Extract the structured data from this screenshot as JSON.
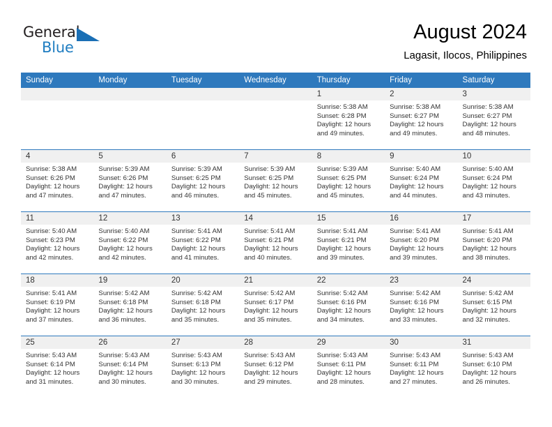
{
  "brand": {
    "name_part1": "General",
    "name_part2": "Blue",
    "triangle_icon": "triangle-icon"
  },
  "header": {
    "title": "August 2024",
    "subtitle": "Lagasit, Ilocos, Philippines"
  },
  "colors": {
    "header_blue": "#2e79bd",
    "brand_blue": "#1f7dc1",
    "daynum_bg": "#f0f0f0",
    "text": "#333333"
  },
  "weekdays": [
    "Sunday",
    "Monday",
    "Tuesday",
    "Wednesday",
    "Thursday",
    "Friday",
    "Saturday"
  ],
  "labels": {
    "sunrise_prefix": "Sunrise:",
    "sunset_prefix": "Sunset:",
    "daylight_prefix": "Daylight:"
  },
  "weeks": [
    [
      {
        "day": "",
        "empty": true
      },
      {
        "day": "",
        "empty": true
      },
      {
        "day": "",
        "empty": true
      },
      {
        "day": "",
        "empty": true
      },
      {
        "day": "1",
        "sunrise": "Sunrise: 5:38 AM",
        "sunset": "Sunset: 6:28 PM",
        "daylight1": "Daylight: 12 hours",
        "daylight2": "and 49 minutes."
      },
      {
        "day": "2",
        "sunrise": "Sunrise: 5:38 AM",
        "sunset": "Sunset: 6:27 PM",
        "daylight1": "Daylight: 12 hours",
        "daylight2": "and 49 minutes."
      },
      {
        "day": "3",
        "sunrise": "Sunrise: 5:38 AM",
        "sunset": "Sunset: 6:27 PM",
        "daylight1": "Daylight: 12 hours",
        "daylight2": "and 48 minutes."
      }
    ],
    [
      {
        "day": "4",
        "sunrise": "Sunrise: 5:38 AM",
        "sunset": "Sunset: 6:26 PM",
        "daylight1": "Daylight: 12 hours",
        "daylight2": "and 47 minutes."
      },
      {
        "day": "5",
        "sunrise": "Sunrise: 5:39 AM",
        "sunset": "Sunset: 6:26 PM",
        "daylight1": "Daylight: 12 hours",
        "daylight2": "and 47 minutes."
      },
      {
        "day": "6",
        "sunrise": "Sunrise: 5:39 AM",
        "sunset": "Sunset: 6:25 PM",
        "daylight1": "Daylight: 12 hours",
        "daylight2": "and 46 minutes."
      },
      {
        "day": "7",
        "sunrise": "Sunrise: 5:39 AM",
        "sunset": "Sunset: 6:25 PM",
        "daylight1": "Daylight: 12 hours",
        "daylight2": "and 45 minutes."
      },
      {
        "day": "8",
        "sunrise": "Sunrise: 5:39 AM",
        "sunset": "Sunset: 6:25 PM",
        "daylight1": "Daylight: 12 hours",
        "daylight2": "and 45 minutes."
      },
      {
        "day": "9",
        "sunrise": "Sunrise: 5:40 AM",
        "sunset": "Sunset: 6:24 PM",
        "daylight1": "Daylight: 12 hours",
        "daylight2": "and 44 minutes."
      },
      {
        "day": "10",
        "sunrise": "Sunrise: 5:40 AM",
        "sunset": "Sunset: 6:24 PM",
        "daylight1": "Daylight: 12 hours",
        "daylight2": "and 43 minutes."
      }
    ],
    [
      {
        "day": "11",
        "sunrise": "Sunrise: 5:40 AM",
        "sunset": "Sunset: 6:23 PM",
        "daylight1": "Daylight: 12 hours",
        "daylight2": "and 42 minutes."
      },
      {
        "day": "12",
        "sunrise": "Sunrise: 5:40 AM",
        "sunset": "Sunset: 6:22 PM",
        "daylight1": "Daylight: 12 hours",
        "daylight2": "and 42 minutes."
      },
      {
        "day": "13",
        "sunrise": "Sunrise: 5:41 AM",
        "sunset": "Sunset: 6:22 PM",
        "daylight1": "Daylight: 12 hours",
        "daylight2": "and 41 minutes."
      },
      {
        "day": "14",
        "sunrise": "Sunrise: 5:41 AM",
        "sunset": "Sunset: 6:21 PM",
        "daylight1": "Daylight: 12 hours",
        "daylight2": "and 40 minutes."
      },
      {
        "day": "15",
        "sunrise": "Sunrise: 5:41 AM",
        "sunset": "Sunset: 6:21 PM",
        "daylight1": "Daylight: 12 hours",
        "daylight2": "and 39 minutes."
      },
      {
        "day": "16",
        "sunrise": "Sunrise: 5:41 AM",
        "sunset": "Sunset: 6:20 PM",
        "daylight1": "Daylight: 12 hours",
        "daylight2": "and 39 minutes."
      },
      {
        "day": "17",
        "sunrise": "Sunrise: 5:41 AM",
        "sunset": "Sunset: 6:20 PM",
        "daylight1": "Daylight: 12 hours",
        "daylight2": "and 38 minutes."
      }
    ],
    [
      {
        "day": "18",
        "sunrise": "Sunrise: 5:41 AM",
        "sunset": "Sunset: 6:19 PM",
        "daylight1": "Daylight: 12 hours",
        "daylight2": "and 37 minutes."
      },
      {
        "day": "19",
        "sunrise": "Sunrise: 5:42 AM",
        "sunset": "Sunset: 6:18 PM",
        "daylight1": "Daylight: 12 hours",
        "daylight2": "and 36 minutes."
      },
      {
        "day": "20",
        "sunrise": "Sunrise: 5:42 AM",
        "sunset": "Sunset: 6:18 PM",
        "daylight1": "Daylight: 12 hours",
        "daylight2": "and 35 minutes."
      },
      {
        "day": "21",
        "sunrise": "Sunrise: 5:42 AM",
        "sunset": "Sunset: 6:17 PM",
        "daylight1": "Daylight: 12 hours",
        "daylight2": "and 35 minutes."
      },
      {
        "day": "22",
        "sunrise": "Sunrise: 5:42 AM",
        "sunset": "Sunset: 6:16 PM",
        "daylight1": "Daylight: 12 hours",
        "daylight2": "and 34 minutes."
      },
      {
        "day": "23",
        "sunrise": "Sunrise: 5:42 AM",
        "sunset": "Sunset: 6:16 PM",
        "daylight1": "Daylight: 12 hours",
        "daylight2": "and 33 minutes."
      },
      {
        "day": "24",
        "sunrise": "Sunrise: 5:42 AM",
        "sunset": "Sunset: 6:15 PM",
        "daylight1": "Daylight: 12 hours",
        "daylight2": "and 32 minutes."
      }
    ],
    [
      {
        "day": "25",
        "sunrise": "Sunrise: 5:43 AM",
        "sunset": "Sunset: 6:14 PM",
        "daylight1": "Daylight: 12 hours",
        "daylight2": "and 31 minutes."
      },
      {
        "day": "26",
        "sunrise": "Sunrise: 5:43 AM",
        "sunset": "Sunset: 6:14 PM",
        "daylight1": "Daylight: 12 hours",
        "daylight2": "and 30 minutes."
      },
      {
        "day": "27",
        "sunrise": "Sunrise: 5:43 AM",
        "sunset": "Sunset: 6:13 PM",
        "daylight1": "Daylight: 12 hours",
        "daylight2": "and 30 minutes."
      },
      {
        "day": "28",
        "sunrise": "Sunrise: 5:43 AM",
        "sunset": "Sunset: 6:12 PM",
        "daylight1": "Daylight: 12 hours",
        "daylight2": "and 29 minutes."
      },
      {
        "day": "29",
        "sunrise": "Sunrise: 5:43 AM",
        "sunset": "Sunset: 6:11 PM",
        "daylight1": "Daylight: 12 hours",
        "daylight2": "and 28 minutes."
      },
      {
        "day": "30",
        "sunrise": "Sunrise: 5:43 AM",
        "sunset": "Sunset: 6:11 PM",
        "daylight1": "Daylight: 12 hours",
        "daylight2": "and 27 minutes."
      },
      {
        "day": "31",
        "sunrise": "Sunrise: 5:43 AM",
        "sunset": "Sunset: 6:10 PM",
        "daylight1": "Daylight: 12 hours",
        "daylight2": "and 26 minutes."
      }
    ]
  ]
}
